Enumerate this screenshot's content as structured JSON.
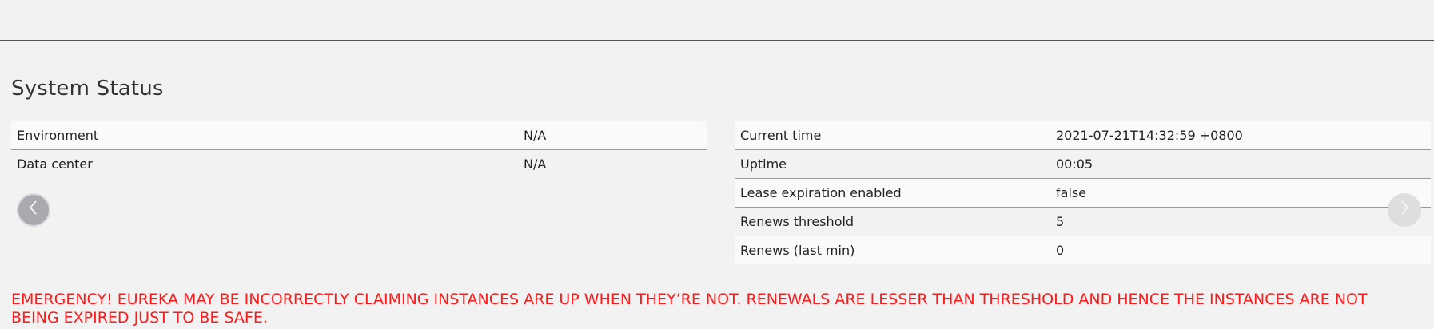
{
  "page_title": "System Status",
  "left_table": [
    {
      "label": "Environment",
      "value": "N/A"
    },
    {
      "label": "Data center",
      "value": "N/A"
    }
  ],
  "right_table": [
    {
      "label": "Current time",
      "value": "2021-07-21T14:32:59 +0800"
    },
    {
      "label": "Uptime",
      "value": "00:05"
    },
    {
      "label": "Lease expiration enabled",
      "value": "false"
    },
    {
      "label": "Renews threshold",
      "value": "5"
    },
    {
      "label": "Renews (last min)",
      "value": "0"
    }
  ],
  "icons": {
    "prev": "chevron-left-icon",
    "next": "chevron-right-icon"
  },
  "emergency_message": "EMERGENCY! EUREKA MAY BE INCORRECTLY CLAIMING INSTANCES ARE UP WHEN THEY’RE NOT. RENEWALS ARE LESSER THAN THRESHOLD AND HENCE THE INSTANCES ARE NOT BEING EXPIRED JUST TO BE SAFE.",
  "colors": {
    "emergency": "#ff1a1a",
    "background": "#f2f2f2"
  }
}
